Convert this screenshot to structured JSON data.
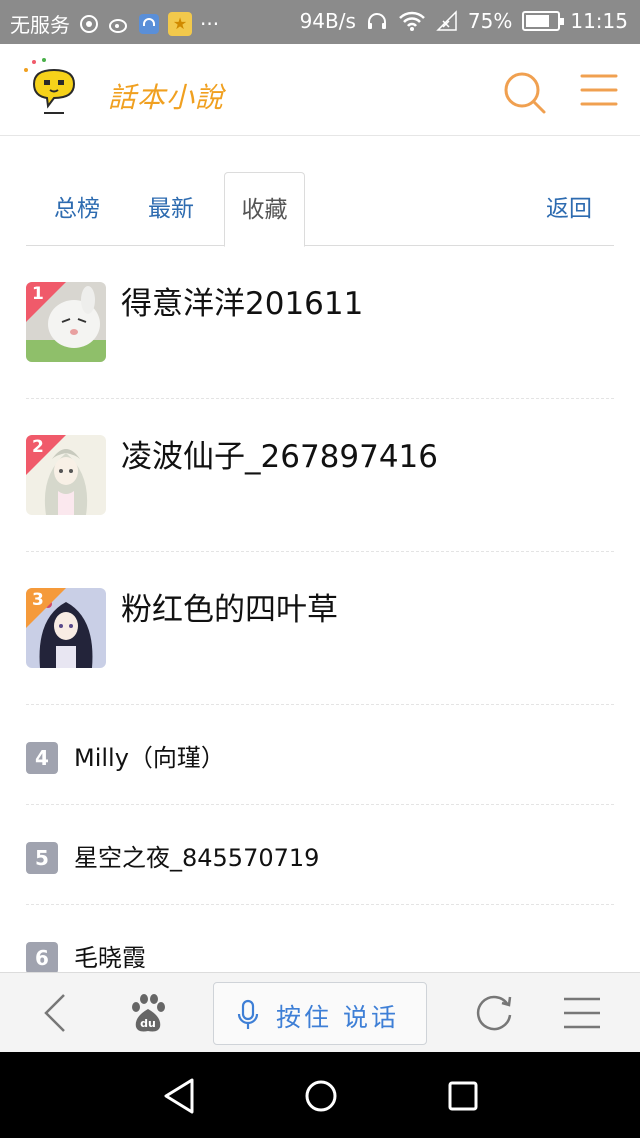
{
  "status_bar": {
    "carrier": "无服务",
    "speed": "94B/s",
    "battery": "75%",
    "battery_level": 0.75,
    "time": "11:15"
  },
  "header": {
    "logo_text": "話本小說"
  },
  "tabs": [
    {
      "label": "总榜",
      "active": false
    },
    {
      "label": "最新",
      "active": false
    },
    {
      "label": "收藏",
      "active": true
    },
    {
      "label": "返回",
      "active": false
    }
  ],
  "ranking": [
    {
      "rank": "1",
      "name": "得意洋洋201611"
    },
    {
      "rank": "2",
      "name": "凌波仙子_267897416"
    },
    {
      "rank": "3",
      "name": "粉红色的四叶草"
    },
    {
      "rank": "4",
      "name": "Milly（向瑾）"
    },
    {
      "rank": "5",
      "name": "星空之夜_845570719"
    },
    {
      "rank": "6",
      "name": "毛晓霞"
    }
  ],
  "browser_bar": {
    "voice_label": "按住 说话",
    "baidu_text": "du"
  },
  "colors": {
    "accent_orange": "#f0a020",
    "tab_blue": "#2d6bb0",
    "rank_red": "#f05a6a",
    "rank_orange": "#f59a3a",
    "rank_gray": "#a0a3af",
    "voice_blue": "#3e7fd6"
  }
}
